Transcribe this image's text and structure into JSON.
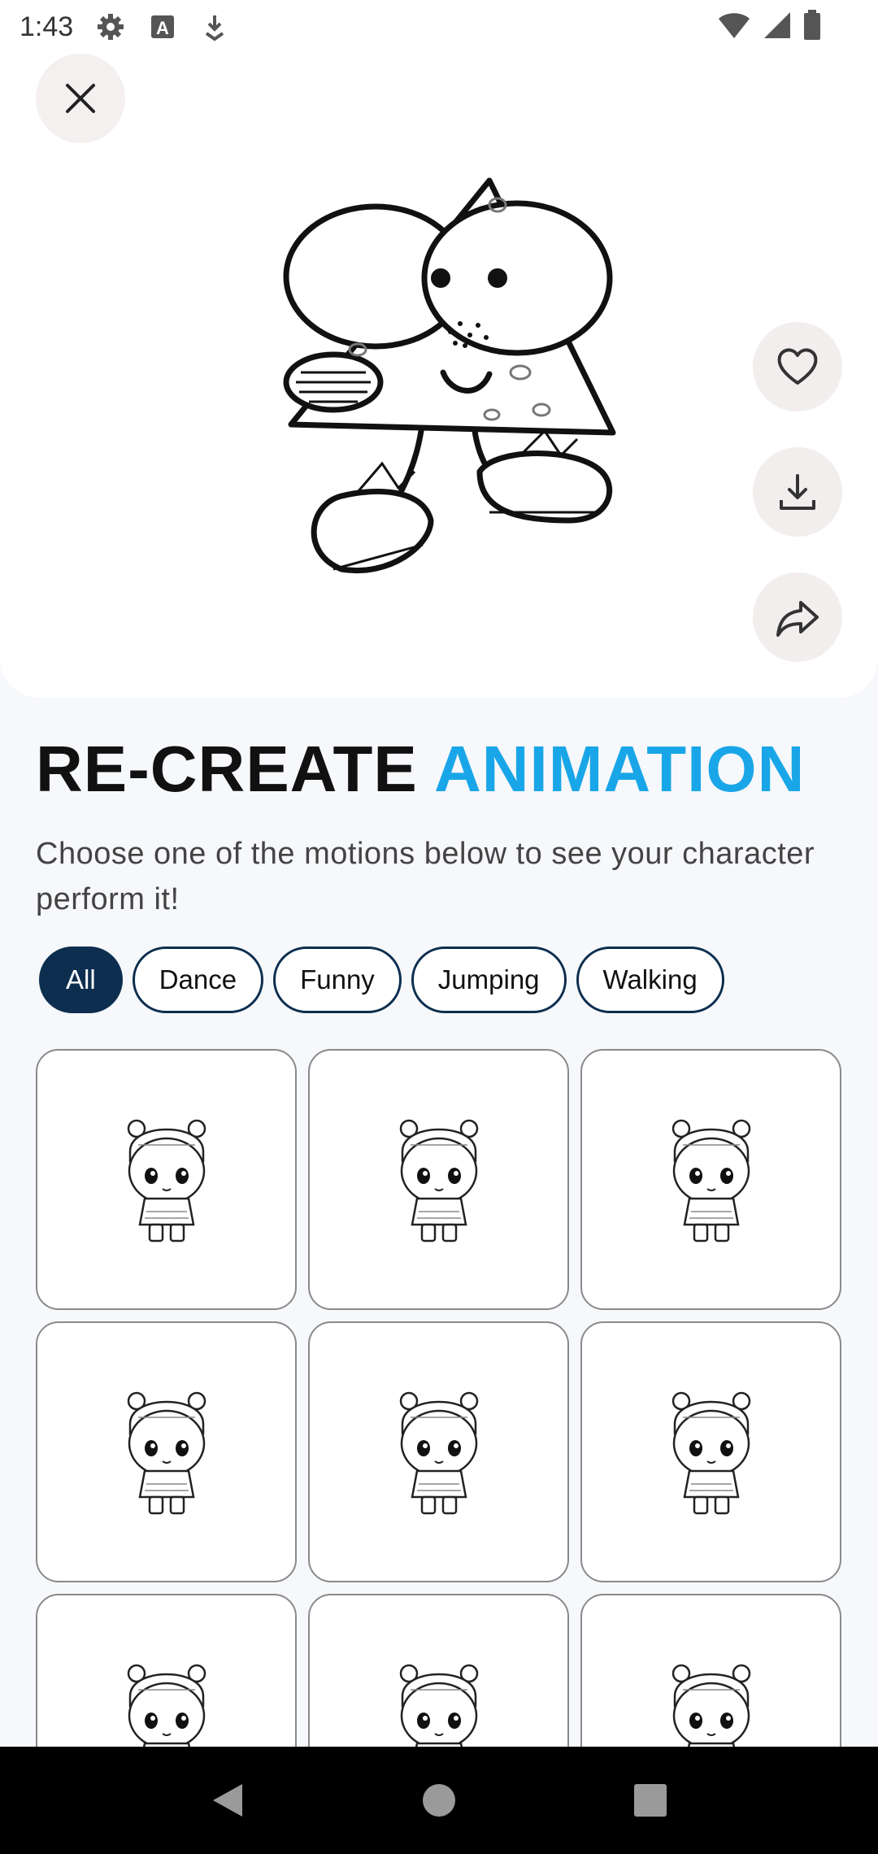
{
  "status_bar": {
    "time": "1:43",
    "left_icons": [
      "gear-icon",
      "text-a-icon",
      "download-status-icon"
    ],
    "right_icons": [
      "wifi-icon",
      "signal-icon",
      "battery-icon"
    ]
  },
  "header": {
    "close_icon": "close-icon",
    "actions": [
      "heart-icon",
      "download-icon",
      "share-icon"
    ]
  },
  "title": {
    "part1": "RE-CREATE ",
    "part2": "ANIMATION",
    "accent_color": "#19a6e8"
  },
  "subtitle": "Choose one of the motions below to see your character perform it!",
  "filters": [
    {
      "label": "All",
      "active": true
    },
    {
      "label": "Dance",
      "active": false
    },
    {
      "label": "Funny",
      "active": false
    },
    {
      "label": "Jumping",
      "active": false
    },
    {
      "label": "Walking",
      "active": false
    }
  ],
  "motions_count_visible": 9,
  "colors": {
    "chip_dark": "#0d2e4f",
    "accent": "#19a6e8"
  },
  "nav": [
    "back-icon",
    "home-icon",
    "recents-icon"
  ]
}
